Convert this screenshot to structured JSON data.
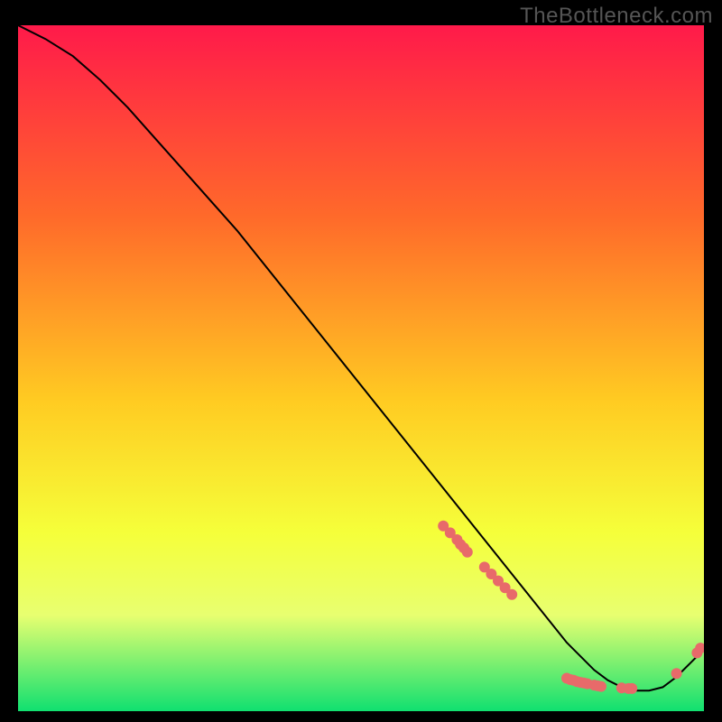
{
  "watermark": "TheBottleneck.com",
  "colors": {
    "gradient_top": "#ff1a4a",
    "gradient_mid_upper": "#ff6a2a",
    "gradient_mid": "#ffcc22",
    "gradient_mid_lower": "#f5ff3a",
    "gradient_band": "#e8ff70",
    "gradient_bottom": "#10e070",
    "line": "#000000",
    "marker": "#e86a6a",
    "background": "#000000"
  },
  "chart_data": {
    "type": "line",
    "title": "",
    "xlabel": "",
    "ylabel": "",
    "xlim": [
      0,
      100
    ],
    "ylim": [
      0,
      100
    ],
    "grid": false,
    "legend": false,
    "series": [
      {
        "name": "curve",
        "x": [
          0,
          4,
          8,
          12,
          16,
          20,
          24,
          28,
          32,
          36,
          40,
          44,
          48,
          52,
          56,
          60,
          64,
          68,
          72,
          76,
          80,
          82,
          84,
          86,
          88,
          90,
          92,
          94,
          96,
          98,
          100
        ],
        "y": [
          100,
          98,
          95.5,
          92,
          88,
          83.5,
          79,
          74.5,
          70,
          65,
          60,
          55,
          50,
          45,
          40,
          35,
          30,
          25,
          20,
          15,
          10,
          8,
          6,
          4.5,
          3.5,
          3,
          3,
          3.5,
          5,
          7,
          9
        ]
      }
    ],
    "markers": [
      {
        "x": 62,
        "y": 27
      },
      {
        "x": 63,
        "y": 26
      },
      {
        "x": 64,
        "y": 25
      },
      {
        "x": 64.5,
        "y": 24.3
      },
      {
        "x": 65,
        "y": 23.8
      },
      {
        "x": 65.5,
        "y": 23.2
      },
      {
        "x": 68,
        "y": 21
      },
      {
        "x": 69,
        "y": 20
      },
      {
        "x": 70,
        "y": 19
      },
      {
        "x": 71,
        "y": 18
      },
      {
        "x": 72,
        "y": 17
      },
      {
        "x": 80,
        "y": 4.8
      },
      {
        "x": 80.5,
        "y": 4.6
      },
      {
        "x": 81,
        "y": 4.5
      },
      {
        "x": 81.5,
        "y": 4.3
      },
      {
        "x": 82,
        "y": 4.2
      },
      {
        "x": 82.5,
        "y": 4.1
      },
      {
        "x": 83,
        "y": 4.0
      },
      {
        "x": 84,
        "y": 3.8
      },
      {
        "x": 84.5,
        "y": 3.7
      },
      {
        "x": 85,
        "y": 3.6
      },
      {
        "x": 88,
        "y": 3.4
      },
      {
        "x": 89,
        "y": 3.3
      },
      {
        "x": 89.5,
        "y": 3.3
      },
      {
        "x": 96,
        "y": 5.5
      },
      {
        "x": 99,
        "y": 8.5
      },
      {
        "x": 99.5,
        "y": 9.2
      }
    ]
  }
}
